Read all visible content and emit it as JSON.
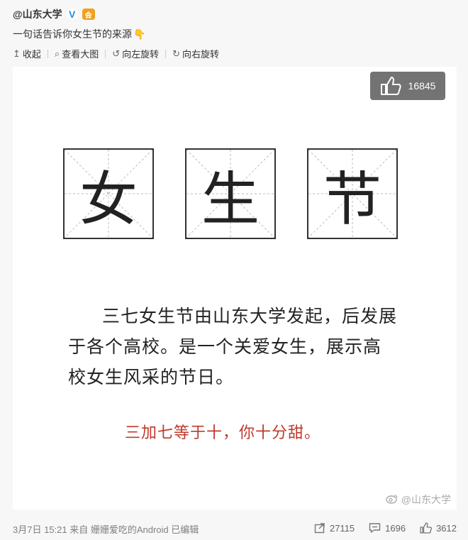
{
  "post": {
    "author": "@山东大学",
    "badge": "会",
    "text": "一句话告诉你女生节的来源",
    "hand_emoji": "👇"
  },
  "toolbar": {
    "collapse": "收起",
    "view_large": "查看大图",
    "rotate_left": "向左旋转",
    "rotate_right": "向右旋转"
  },
  "image": {
    "like_count": "16845",
    "chars": [
      "女",
      "生",
      "节"
    ],
    "body_lines": [
      "三七女生节由山东大学发起，后发展",
      "于各个高校。是一个关爱女生，展示高",
      "校女生风采的节日。"
    ],
    "red_line": "三加七等于十，你十分甜。",
    "watermark": "@山东大学"
  },
  "footer": {
    "meta": "3月7日 15:21 来自 姗姗爱吃的Android  已编辑",
    "reposts": "27115",
    "comments": "1696",
    "likes": "3612"
  },
  "colors": {
    "background": "#f7f7f7",
    "image_bg": "#ffffff",
    "red_text": "#c0392b",
    "verify_blue": "#1f8fe6"
  }
}
